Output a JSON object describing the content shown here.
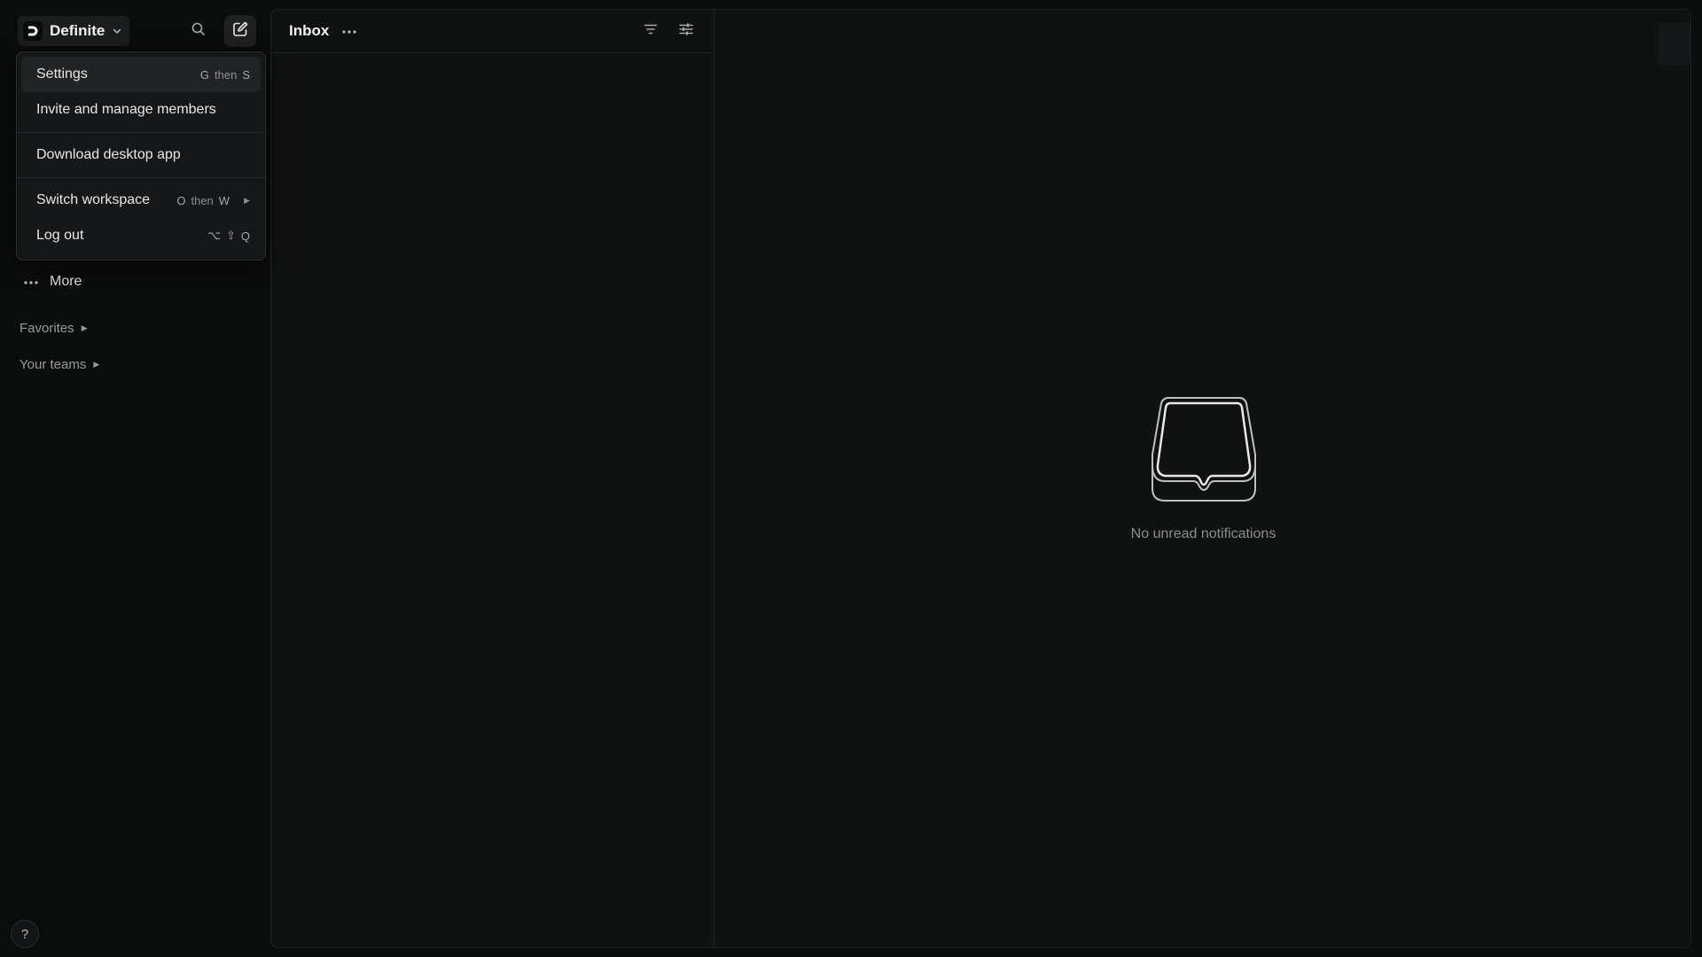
{
  "workspace": {
    "name": "Definite",
    "logo_letter": "D"
  },
  "sidebar": {
    "more_label": "More",
    "favorites_label": "Favorites",
    "teams_label": "Your teams",
    "help_label": "?"
  },
  "menu": {
    "items": [
      {
        "label": "Settings",
        "shortcut": [
          "G",
          "then",
          "S"
        ]
      },
      {
        "label": "Invite and manage members"
      },
      {
        "label": "Download desktop app"
      },
      {
        "label": "Switch workspace",
        "shortcut": [
          "O",
          "then",
          "W"
        ]
      },
      {
        "label": "Log out",
        "shortcut": [
          "⌥",
          "⇧",
          "Q"
        ]
      }
    ]
  },
  "inbox": {
    "title": "Inbox",
    "empty_text": "No unread notifications"
  },
  "icons": {
    "search": "search-icon",
    "compose": "compose-icon",
    "filter": "filter-icon",
    "display_options": "sliders-icon",
    "more": "ellipsis-icon",
    "empty_inbox": "inbox-tray-icon"
  },
  "colors": {
    "background": "#0b0c0c",
    "panel": "#101111",
    "menu": "#161718",
    "text_muted": "#8c8d90"
  }
}
